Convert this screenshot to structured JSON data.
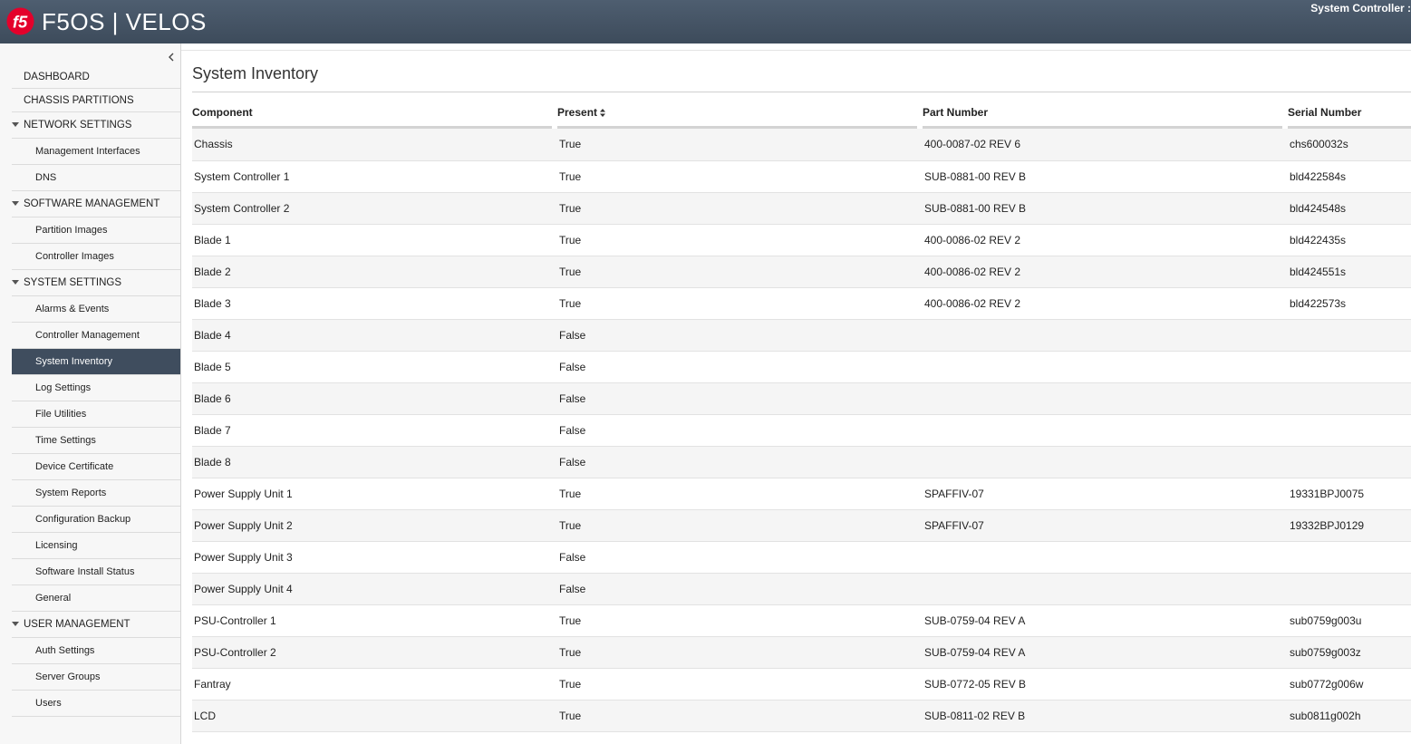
{
  "header": {
    "brand": "F5OS | VELOS",
    "context": "System Controller :"
  },
  "sidebar": {
    "items": [
      {
        "id": "dashboard",
        "label": "DASHBOARD",
        "kind": "top"
      },
      {
        "id": "chassis-partitions",
        "label": "CHASSIS PARTITIONS",
        "kind": "top"
      },
      {
        "id": "network-settings",
        "label": "NETWORK SETTINGS",
        "kind": "section"
      },
      {
        "id": "management-interfaces",
        "label": "Management Interfaces",
        "kind": "sub"
      },
      {
        "id": "dns",
        "label": "DNS",
        "kind": "sub"
      },
      {
        "id": "software-management",
        "label": "SOFTWARE MANAGEMENT",
        "kind": "section"
      },
      {
        "id": "partition-images",
        "label": "Partition Images",
        "kind": "sub"
      },
      {
        "id": "controller-images",
        "label": "Controller Images",
        "kind": "sub"
      },
      {
        "id": "system-settings",
        "label": "SYSTEM SETTINGS",
        "kind": "section"
      },
      {
        "id": "alarms-events",
        "label": "Alarms & Events",
        "kind": "sub"
      },
      {
        "id": "controller-management",
        "label": "Controller Management",
        "kind": "sub"
      },
      {
        "id": "system-inventory",
        "label": "System Inventory",
        "kind": "sub",
        "active": true
      },
      {
        "id": "log-settings",
        "label": "Log Settings",
        "kind": "sub"
      },
      {
        "id": "file-utilities",
        "label": "File Utilities",
        "kind": "sub"
      },
      {
        "id": "time-settings",
        "label": "Time Settings",
        "kind": "sub"
      },
      {
        "id": "device-certificate",
        "label": "Device Certificate",
        "kind": "sub"
      },
      {
        "id": "system-reports",
        "label": "System Reports",
        "kind": "sub"
      },
      {
        "id": "configuration-backup",
        "label": "Configuration Backup",
        "kind": "sub"
      },
      {
        "id": "licensing",
        "label": "Licensing",
        "kind": "sub"
      },
      {
        "id": "software-install-status",
        "label": "Software Install Status",
        "kind": "sub"
      },
      {
        "id": "general",
        "label": "General",
        "kind": "sub"
      },
      {
        "id": "user-management",
        "label": "USER MANAGEMENT",
        "kind": "section"
      },
      {
        "id": "auth-settings",
        "label": "Auth Settings",
        "kind": "sub"
      },
      {
        "id": "server-groups",
        "label": "Server Groups",
        "kind": "sub"
      },
      {
        "id": "users",
        "label": "Users",
        "kind": "sub"
      }
    ]
  },
  "main": {
    "title": "System Inventory",
    "columns": [
      "Component",
      "Present",
      "Part Number",
      "Serial Number"
    ],
    "rows": [
      [
        "Chassis",
        "True",
        "400-0087-02 REV 6",
        "chs600032s"
      ],
      [
        "System Controller 1",
        "True",
        "SUB-0881-00 REV B",
        "bld422584s"
      ],
      [
        "System Controller 2",
        "True",
        "SUB-0881-00 REV B",
        "bld424548s"
      ],
      [
        "Blade 1",
        "True",
        "400-0086-02 REV 2",
        "bld422435s"
      ],
      [
        "Blade 2",
        "True",
        "400-0086-02 REV 2",
        "bld424551s"
      ],
      [
        "Blade 3",
        "True",
        "400-0086-02 REV 2",
        "bld422573s"
      ],
      [
        "Blade 4",
        "False",
        "",
        ""
      ],
      [
        "Blade 5",
        "False",
        "",
        ""
      ],
      [
        "Blade 6",
        "False",
        "",
        ""
      ],
      [
        "Blade 7",
        "False",
        "",
        ""
      ],
      [
        "Blade 8",
        "False",
        "",
        ""
      ],
      [
        "Power Supply Unit 1",
        "True",
        "SPAFFIV-07",
        "19331BPJ0075"
      ],
      [
        "Power Supply Unit 2",
        "True",
        "SPAFFIV-07",
        "19332BPJ0129"
      ],
      [
        "Power Supply Unit 3",
        "False",
        "",
        ""
      ],
      [
        "Power Supply Unit 4",
        "False",
        "",
        ""
      ],
      [
        "PSU-Controller 1",
        "True",
        "SUB-0759-04 REV A",
        "sub0759g003u"
      ],
      [
        "PSU-Controller 2",
        "True",
        "SUB-0759-04 REV A",
        "sub0759g003z"
      ],
      [
        "Fantray",
        "True",
        "SUB-0772-05 REV B",
        "sub0772g006w"
      ],
      [
        "LCD",
        "True",
        "SUB-0811-02 REV B",
        "sub0811g002h"
      ]
    ]
  },
  "icons": {
    "logo": "f5-logo-icon",
    "collapse": "chevron-left-icon",
    "section_caret": "caret-down-icon",
    "sort": "sort-icon"
  },
  "colors": {
    "header": "#3d4b5b",
    "active_nav": "#3f4d5e",
    "logo_red": "#e4002b"
  }
}
